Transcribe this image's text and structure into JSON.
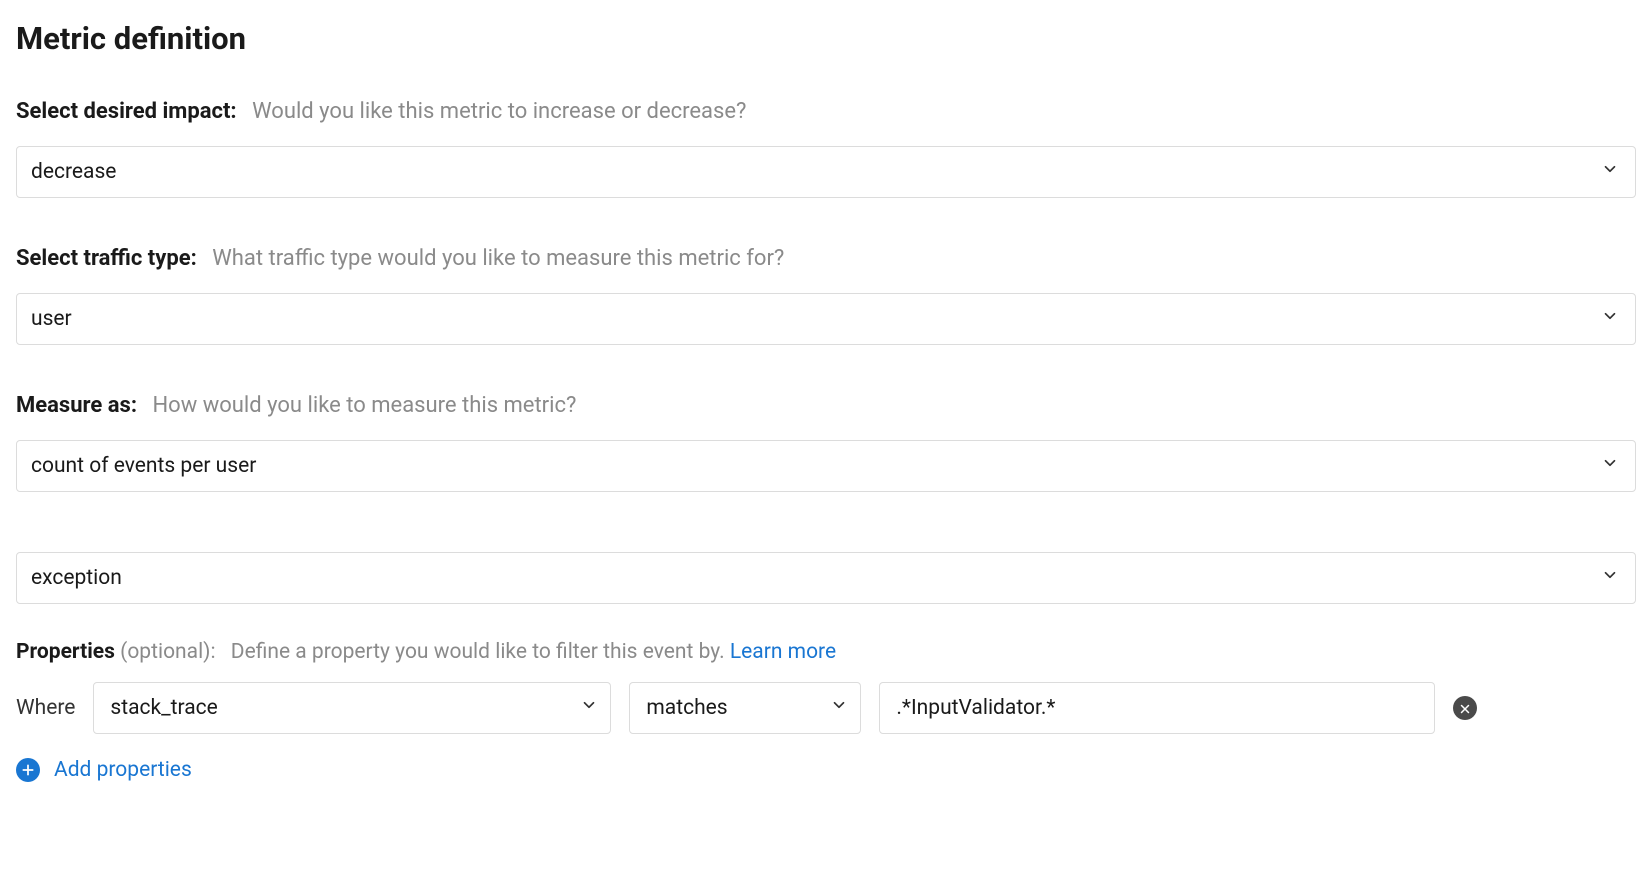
{
  "page_title": "Metric definition",
  "impact": {
    "label": "Select desired impact:",
    "hint": "Would you like this metric to increase or decrease?",
    "value": "decrease"
  },
  "traffic": {
    "label": "Select traffic type:",
    "hint": "What traffic type would you like to measure this metric for?",
    "value": "user"
  },
  "measure": {
    "label": "Measure as:",
    "hint": "How would you like to measure this metric?",
    "agg_value": "count of events per user",
    "event_value": "exception"
  },
  "properties": {
    "label": "Properties",
    "optional": "(optional):",
    "desc": "Define a property you would like to filter this event by.",
    "learn_more": "Learn more",
    "where_label": "Where",
    "filter": {
      "property": "stack_trace",
      "operator": "matches",
      "value": ".*InputValidator.*"
    },
    "add_label": "Add properties"
  }
}
